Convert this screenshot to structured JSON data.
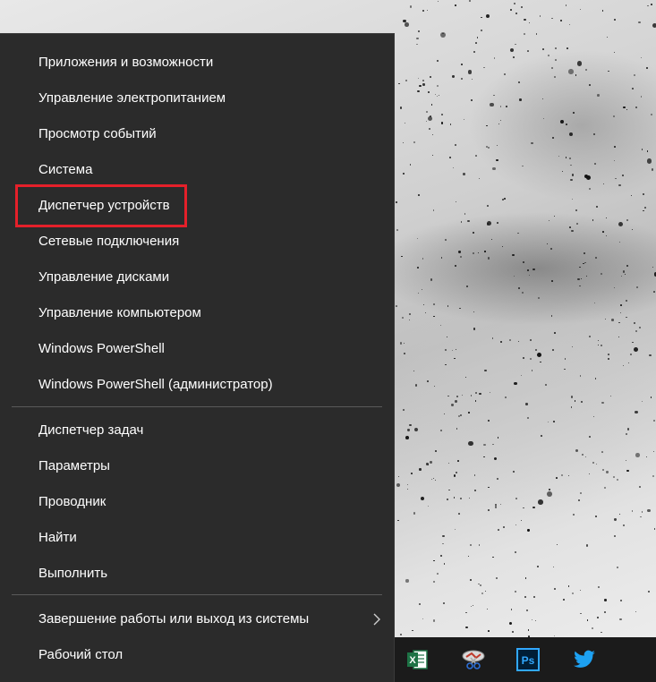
{
  "menu": {
    "group1": [
      {
        "label": "Приложения и возможности"
      },
      {
        "label": "Управление электропитанием"
      },
      {
        "label": "Просмотр событий"
      },
      {
        "label": "Система"
      },
      {
        "label": "Диспетчер устройств"
      },
      {
        "label": "Сетевые подключения"
      },
      {
        "label": "Управление дисками"
      },
      {
        "label": "Управление компьютером"
      },
      {
        "label": "Windows PowerShell"
      },
      {
        "label": "Windows PowerShell (администратор)"
      }
    ],
    "group2": [
      {
        "label": "Диспетчер задач"
      },
      {
        "label": "Параметры"
      },
      {
        "label": "Проводник"
      },
      {
        "label": "Найти"
      },
      {
        "label": "Выполнить"
      }
    ],
    "group3": [
      {
        "label": "Завершение работы или выход из системы",
        "has_submenu": true
      },
      {
        "label": "Рабочий стол"
      }
    ],
    "highlighted_item": "Диспетчер устройств",
    "highlight_color": "#e5202a",
    "background_color": "#2b2b2b"
  },
  "taskbar": {
    "icons": [
      {
        "name": "excel-icon",
        "text": "X",
        "color": "#1d7245"
      },
      {
        "name": "snipping-tool-icon",
        "color": "#c0392b"
      },
      {
        "name": "photoshop-icon",
        "text": "Ps",
        "color": "#31a8ff"
      },
      {
        "name": "twitter-icon",
        "color": "#1da1f2"
      }
    ]
  }
}
